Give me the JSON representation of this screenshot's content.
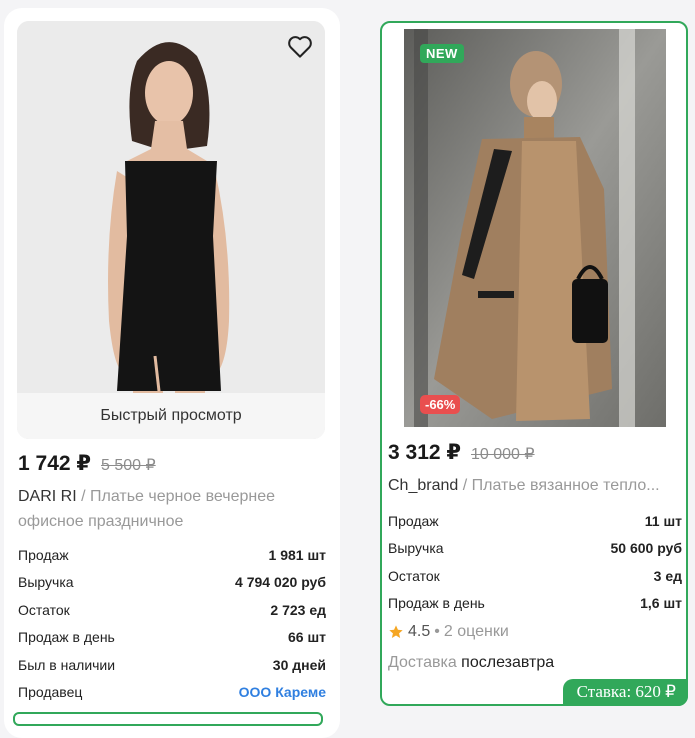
{
  "cards": [
    {
      "quick_view": "Быстрый просмотр",
      "price": "1 742 ₽",
      "old_price": "5 500 ₽",
      "brand": "DARI RI",
      "name": " / Платье черное вечернее офисное праздничное",
      "stats": [
        {
          "label": "Продаж",
          "value": "1 981 шт"
        },
        {
          "label": "Выручка",
          "value": "4 794 020 руб"
        },
        {
          "label": "Остаток",
          "value": "2 723 ед"
        },
        {
          "label": "Продаж в день",
          "value": "66 шт"
        },
        {
          "label": "Был в наличии",
          "value": "30 дней"
        },
        {
          "label": "Продавец",
          "value": "ООО Кареме"
        }
      ],
      "icons": {
        "favorite": "heart-outline-icon"
      }
    },
    {
      "badge_new": "NEW",
      "badge_discount": "-66%",
      "price": "3 312 ₽",
      "old_price": "10 000 ₽",
      "brand": "Ch_brand",
      "name": " / Платье вязанное тепло...",
      "stats": [
        {
          "label": "Продаж",
          "value": "11 шт"
        },
        {
          "label": "Выручка",
          "value": "50 600 руб"
        },
        {
          "label": "Остаток",
          "value": "3 ед"
        },
        {
          "label": "Продаж в день",
          "value": "1,6 шт"
        }
      ],
      "rating": "4.5",
      "rating_sep": "•",
      "reviews": "2 оценки",
      "delivery_label": "Доставка",
      "delivery_value": "послезавтра",
      "bid": "Ставка: 620 ₽",
      "colors": {
        "accent": "#31a85a",
        "discount": "#e94f4f",
        "star": "#f5a623"
      }
    }
  ]
}
